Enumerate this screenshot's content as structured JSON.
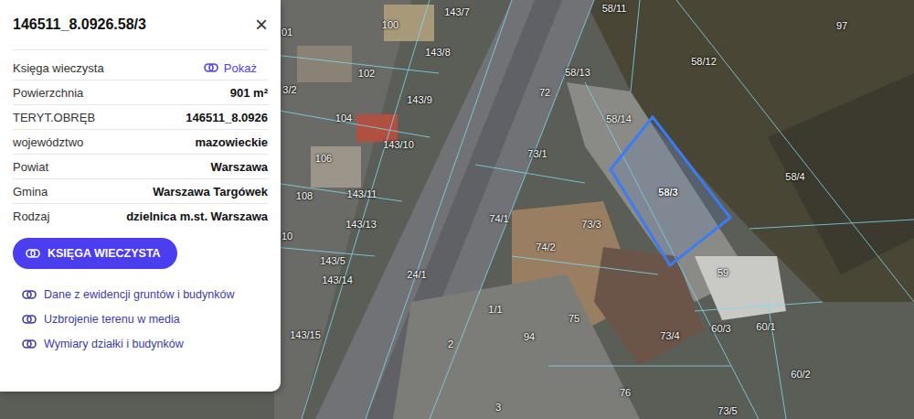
{
  "panel": {
    "title": "146511_8.0926.58/3",
    "close": "×",
    "rows": [
      {
        "label": "Księga wieczysta",
        "value": "Pokaż",
        "kind": "link"
      },
      {
        "label": "Powierzchnia",
        "value": "901 m²",
        "kind": "text"
      },
      {
        "label": "TERYT.OBRĘB",
        "value": "146511_8.0926",
        "kind": "text"
      },
      {
        "label": "województwo",
        "value": "mazowieckie",
        "kind": "text"
      },
      {
        "label": "Powiat",
        "value": "Warszawa",
        "kind": "text"
      },
      {
        "label": "Gmina",
        "value": "Warszawa Targówek",
        "kind": "text"
      },
      {
        "label": "Rodzaj",
        "value": "dzielnica m.st. Warszawa",
        "kind": "text"
      }
    ],
    "button": "KSIĘGA WIECZYSTA",
    "links": [
      "Dane z ewidencji gruntów i budynków",
      "Uzbrojenie terenu w media",
      "Wymiary działki i budynków"
    ]
  },
  "map": {
    "parcels": [
      {
        "label": "143/7",
        "selected": false
      },
      {
        "label": "58/11",
        "selected": false
      },
      {
        "label": "97",
        "selected": false
      },
      {
        "label": "100",
        "selected": false
      },
      {
        "label": "01",
        "selected": false
      },
      {
        "label": "143/8",
        "selected": false
      },
      {
        "label": "58/12",
        "selected": false
      },
      {
        "label": "102",
        "selected": false
      },
      {
        "label": "58/13",
        "selected": false
      },
      {
        "label": "3/2",
        "selected": false
      },
      {
        "label": "72",
        "selected": false
      },
      {
        "label": "143/9",
        "selected": false
      },
      {
        "label": "104",
        "selected": false
      },
      {
        "label": "58/14",
        "selected": false
      },
      {
        "label": "143/10",
        "selected": false
      },
      {
        "label": "73/1",
        "selected": false
      },
      {
        "label": "106",
        "selected": false
      },
      {
        "label": "58/4",
        "selected": false
      },
      {
        "label": "58/3",
        "selected": true
      },
      {
        "label": "143/11",
        "selected": false
      },
      {
        "label": "108",
        "selected": false
      },
      {
        "label": "74/1",
        "selected": false
      },
      {
        "label": "73/3",
        "selected": false
      },
      {
        "label": "143/13",
        "selected": false
      },
      {
        "label": "10",
        "selected": false
      },
      {
        "label": "74/2",
        "selected": false
      },
      {
        "label": "143/5",
        "selected": false
      },
      {
        "label": "59",
        "selected": false
      },
      {
        "label": "24/1",
        "selected": false
      },
      {
        "label": "143/14",
        "selected": false
      },
      {
        "label": "1/1",
        "selected": false
      },
      {
        "label": "75",
        "selected": false
      },
      {
        "label": "60/3",
        "selected": false
      },
      {
        "label": "60/1",
        "selected": false
      },
      {
        "label": "73/4",
        "selected": false
      },
      {
        "label": "143/15",
        "selected": false
      },
      {
        "label": "2",
        "selected": false
      },
      {
        "label": "94",
        "selected": false
      },
      {
        "label": "60/2",
        "selected": false
      },
      {
        "label": "76",
        "selected": false
      },
      {
        "label": "3",
        "selected": false
      },
      {
        "label": "73/5",
        "selected": false
      }
    ]
  }
}
